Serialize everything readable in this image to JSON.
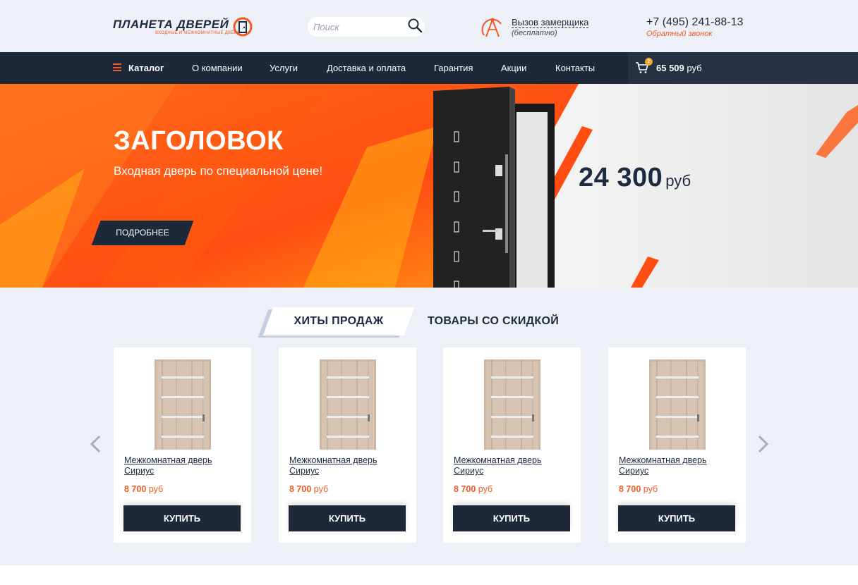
{
  "colors": {
    "accent": "#f15a24",
    "dark": "#1d2838",
    "background": "#edf0f6"
  },
  "header": {
    "logo_title": "ПЛАНЕТА ДВЕРЕЙ",
    "logo_subtitle": "ВХОДНЫЕ И МЕЖКОМНАТНЫЕ ДВЕРИ",
    "search_placeholder": "Поиск",
    "measure_title": "Вызов замерщика",
    "measure_subtitle": "(бесплатно)",
    "phone": "+7 (495) 241-88-13",
    "callback": "Обратный звонок"
  },
  "nav": {
    "items": [
      {
        "label": "Каталог"
      },
      {
        "label": "О компании"
      },
      {
        "label": "Услуги"
      },
      {
        "label": "Доставка и оплата"
      },
      {
        "label": "Гарантия"
      },
      {
        "label": "Акции"
      },
      {
        "label": "Контакты"
      }
    ],
    "cart": {
      "count": "2",
      "amount": "65 509",
      "currency": "руб"
    }
  },
  "hero": {
    "title": "ЗАГОЛОВОК",
    "subtitle": "Входная дверь по специальной цене!",
    "button": "ПОДРОБНЕЕ",
    "price": "24 300",
    "currency": "руб"
  },
  "products": {
    "tabs": [
      {
        "label": "ХИТЫ ПРОДАЖ",
        "active": true
      },
      {
        "label": "ТОВАРЫ СО СКИДКОЙ",
        "active": false
      }
    ],
    "items": [
      {
        "name": "Межкомнатная дверь Сириус",
        "price": "8 700",
        "currency": "руб",
        "button": "КУПИТЬ"
      },
      {
        "name": "Межкомнатная дверь Сириус",
        "price": "8 700",
        "currency": "руб",
        "button": "КУПИТЬ"
      },
      {
        "name": "Межкомнатная дверь Сириус",
        "price": "8 700",
        "currency": "руб",
        "button": "КУПИТЬ"
      },
      {
        "name": "Межкомнатная дверь Сириус",
        "price": "8 700",
        "currency": "руб",
        "button": "КУПИТЬ"
      }
    ]
  }
}
